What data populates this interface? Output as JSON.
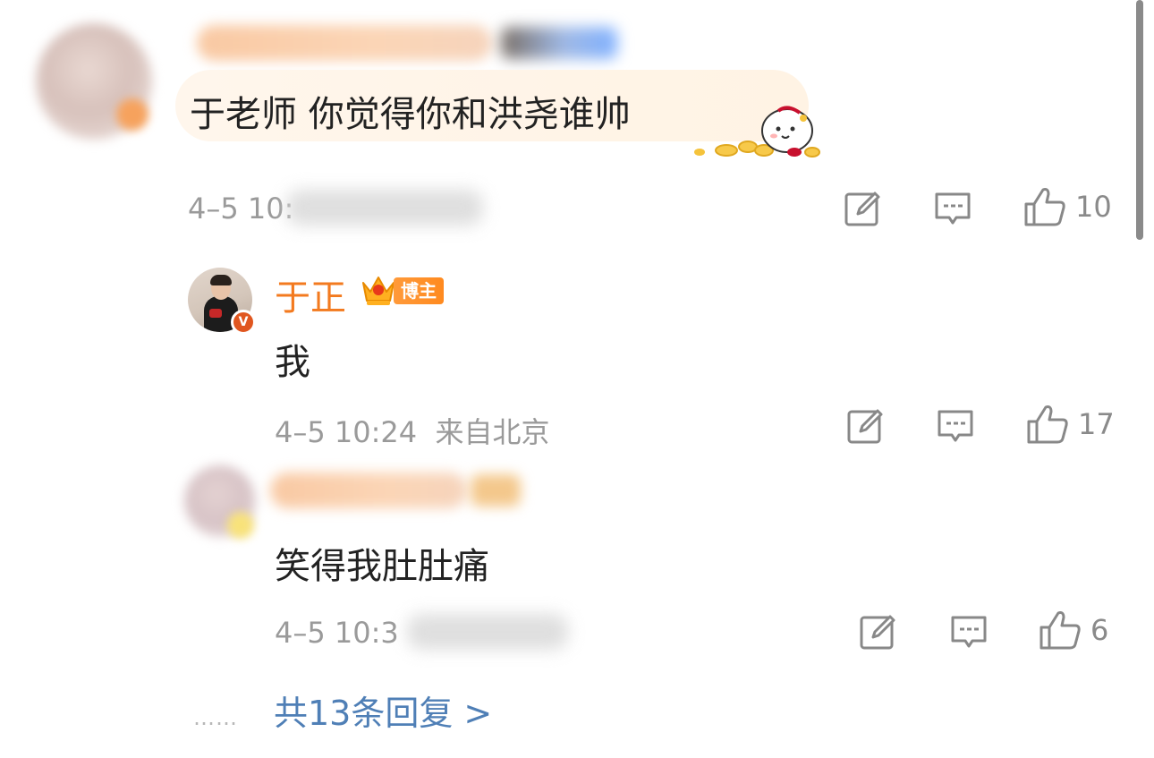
{
  "comment": {
    "text": "于老师 你觉得你和洪尧谁帅",
    "time_visible": "4–5 10:",
    "like_count": "10"
  },
  "reply_blogger": {
    "author": "于正",
    "badge_label": "博主",
    "verified_mark": "V",
    "text": "我",
    "time": "4–5 10:24",
    "location": "来自北京",
    "like_count": "17"
  },
  "reply_user": {
    "text": "笑得我肚肚痛",
    "time_visible": "4–5 10:3",
    "like_count": "6"
  },
  "footer": {
    "dots": "……",
    "more_replies": "共13条回复 >"
  },
  "colors": {
    "accent_orange": "#f37a1f",
    "link_blue": "#4f7fb6",
    "meta_gray": "#9a9a9a"
  },
  "icons": [
    "edit-icon",
    "comment-icon",
    "thumbs-up-icon",
    "crown-icon",
    "verified-icon"
  ]
}
